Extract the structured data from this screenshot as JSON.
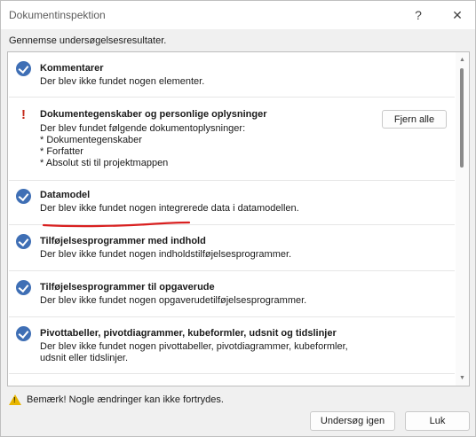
{
  "window": {
    "title": "Dokumentinspektion",
    "help_glyph": "?",
    "close_glyph": "✕"
  },
  "subtitle": "Gennemse undersøgelsesresultater.",
  "results": [
    {
      "status": "ok",
      "title": "Kommentarer",
      "text": "Der blev ikke fundet nogen elementer."
    },
    {
      "status": "issue",
      "title": "Dokumentegenskaber og personlige oplysninger",
      "text": "Der blev fundet følgende dokumentoplysninger:\n* Dokumentegenskaber\n* Forfatter\n* Absolut sti til projektmappen",
      "action_label": "Fjern alle"
    },
    {
      "status": "ok",
      "title": "Datamodel",
      "text": "Der blev ikke fundet nogen integrerede data i datamodellen."
    },
    {
      "status": "ok",
      "title": "Tilføjelsesprogrammer med indhold",
      "text": "Der blev ikke fundet nogen indholdstilføjelsesprogrammer."
    },
    {
      "status": "ok",
      "title": "Tilføjelsesprogrammer til opgaverude",
      "text": "Der blev ikke fundet nogen opgaverudetilføjelsesprogrammer."
    },
    {
      "status": "ok",
      "title": "Pivottabeller, pivotdiagrammer, kubeformler, udsnit og tidslinjer",
      "text": "Der blev ikke fundet nogen pivottabeller, pivotdiagrammer, kubeformler,\nudsnit eller tidslinjer."
    }
  ],
  "footer": {
    "note": "Bemærk! Nogle ændringer kan ikke fortrydes.",
    "reinspect_label": "Undersøg igen",
    "close_label": "Luk"
  },
  "colors": {
    "ok_icon": "#3f6fb5",
    "issue_icon": "#c42b1c",
    "annotation": "#d92020"
  },
  "icons": {
    "ok": "check-circle-icon",
    "issue": "exclamation-icon",
    "footer": "warning-triangle-icon"
  }
}
